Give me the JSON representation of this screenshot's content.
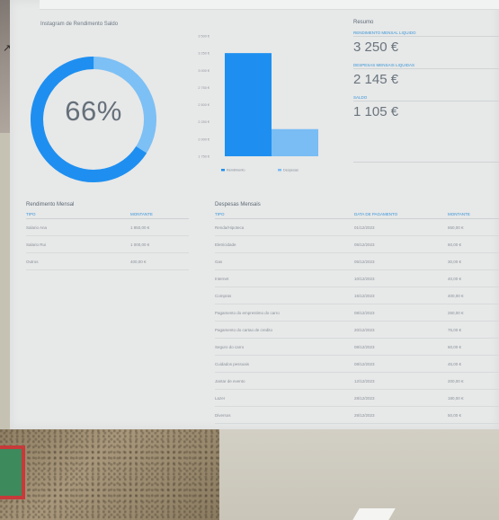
{
  "donut": {
    "title": "Instagram de Rendimento Saldo",
    "percent": 66,
    "percent_label": "66%",
    "colors": {
      "main": "#1e8ff0",
      "secondary": "#7cc0f5"
    }
  },
  "chart_data": {
    "type": "bar",
    "categories": [
      "Rendimento",
      "Despesas"
    ],
    "values": [
      3250,
      2145
    ],
    "yticks": [
      "3 500 €",
      "3 250 €",
      "3 000 €",
      "2 750 €",
      "2 500 €",
      "2 250 €",
      "2 000 €",
      "1 750 €"
    ],
    "ylim": [
      1750,
      3500
    ],
    "legend": [
      "Rendimento",
      "Despesas"
    ],
    "colors": [
      "#1e8ff0",
      "#79bdf4"
    ]
  },
  "summary": {
    "title": "Resumo",
    "items": [
      {
        "label": "RENDIMENTO MENSAL LIQUIDO",
        "value": "3 250 €"
      },
      {
        "label": "DESPESAS MENSAIS LIQUIDAS",
        "value": "2 145 €"
      },
      {
        "label": "SALDO",
        "value": "1 105 €"
      }
    ]
  },
  "income_table": {
    "title": "Rendimento Mensal",
    "headers": [
      "TIPO",
      "MONTANTE"
    ],
    "rows": [
      [
        "Salario Ana",
        "1 850,00 €"
      ],
      [
        "Salario Rui",
        "1 000,00 €"
      ],
      [
        "Outros",
        "400,00 €"
      ]
    ]
  },
  "expense_table": {
    "title": "Despesas Mensais",
    "headers": [
      "TIPO",
      "DATA DE PAGAMENTO",
      "MONTANTE"
    ],
    "rows": [
      [
        "Renda/Hipoteca",
        "01/12/2023",
        "650,00 €"
      ],
      [
        "Eletricidade",
        "05/12/2023",
        "60,00 €"
      ],
      [
        "Gas",
        "05/12/2023",
        "30,00 €"
      ],
      [
        "Internet",
        "10/12/2023",
        "40,00 €"
      ],
      [
        "Compras",
        "15/12/2023",
        "400,00 €"
      ],
      [
        "Pagamento do emprestimo do carro",
        "08/12/2023",
        "250,00 €"
      ],
      [
        "Pagamento do cartao de credito",
        "20/12/2023",
        "75,00 €"
      ],
      [
        "Seguro do carro",
        "08/12/2023",
        "60,00 €"
      ],
      [
        "Cuidados pessoais",
        "08/12/2023",
        "45,00 €"
      ],
      [
        "Jantar de evento",
        "12/12/2023",
        "200,00 €"
      ],
      [
        "Lazer",
        "28/12/2023",
        "180,00 €"
      ],
      [
        "Diversos",
        "28/12/2023",
        "50,00 €"
      ]
    ]
  }
}
